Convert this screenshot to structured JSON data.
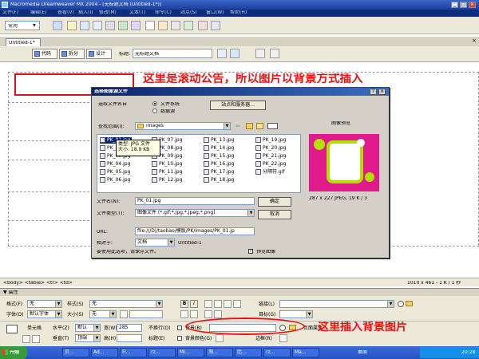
{
  "window": {
    "title": "Macromedia Dreamweaver MX 2004 - [无标题文档 (Untitled-1*)]",
    "menu": [
      "文件(F)",
      "编辑(E)",
      "查看(V)",
      "插入(I)",
      "修改(M)",
      "文本(T)",
      "命令(C)",
      "站点(S)",
      "窗口(W)",
      "帮助(H)"
    ],
    "insert_category": "常用"
  },
  "document": {
    "tab": "Untitled-1*",
    "buttons": {
      "code": "代码",
      "split": "拆分",
      "design": "设计"
    },
    "title_label": "标题:",
    "title_value": "无标题文档"
  },
  "annotations": {
    "top": "这里是滚动公告，所以图片以背景方式插入",
    "bottom": "这里插入背景图片"
  },
  "dialog": {
    "title": "选择图像源文件",
    "select_from_label": "选取文件名自",
    "radio_filesystem": "文件系统",
    "radio_datasource": "数据源",
    "site_server_button": "站点和服务器...",
    "lookin_label": "查找范围(I):",
    "lookin_value": "images",
    "files": [
      [
        "PK_01.jpg",
        "PK_07.jpg",
        "PK_13.jpg",
        "PK_19.jpg"
      ],
      [
        "PK_02.jpg",
        "PK_08.jpg",
        "PK_14.jpg",
        "PK_20.jpg"
      ],
      [
        "PK_03.jpg",
        "PK_09.jpg",
        "PK_15.jpg",
        "PK_21.jpg"
      ],
      [
        "PK_04.jpg",
        "PK_10.jpg",
        "PK_16.jpg",
        "PK_22.jpg"
      ],
      [
        "PK_05.jpg",
        "PK_11.jpg",
        "PK_17.jpg",
        "分隔符.gif"
      ],
      [
        "PK_06.jpg",
        "PK_12.jpg",
        "PK_18.jpg",
        ""
      ]
    ],
    "tooltip_type": "类型: JPG 文件",
    "tooltip_size": "大小: 18.9 KB",
    "filename_label": "文件名(N):",
    "filename_value": "PK_01.jpg",
    "filetype_label": "文件类型(T):",
    "filetype_value": "图像文件 (*.gif;*.jpg;*.jpeg;*.png)",
    "ok_button": "确定",
    "cancel_button": "取消",
    "url_label": "URL:",
    "url_value": "file:///D|/taobao/模版/PK/images/PK_01.jp",
    "relative_label": "相对于:",
    "relative_value": "文档",
    "relative_doc": "Untitled-1",
    "hint": "要使用此选项，请保存文件。",
    "preview_title": "图像预览",
    "preview_checkbox": "预览图像",
    "preview_info": "287 x 227 JPEG, 19 K / 3"
  },
  "status": {
    "tags": "<body> <table> <tr> <td>",
    "size": "1010 x 461 - 1 K / 1 秒"
  },
  "properties": {
    "header": "▼ 属性",
    "format_label": "格式(F)",
    "format_value": "无",
    "style_label": "样式(S)",
    "style_value": "无",
    "font_label": "字体(O)",
    "font_value": "默认字体",
    "size_label": "大小(S)",
    "size_value": "无",
    "bold": "B",
    "italic": "I",
    "link_label": "链接(L)",
    "target_label": "目标(G)",
    "cell_label": "单元格",
    "horz_label": "水平(Z)",
    "horz_value": "默认",
    "width_label": "宽(W)",
    "width_value": "285",
    "nowrap_label": "不换行(O)",
    "bg_label": "背景(B)",
    "vert_label": "垂直(T)",
    "vert_value": "顶端",
    "height_label": "高(H)",
    "header_label": "标题(E)",
    "bgcolor_label": "背景颜色(G)",
    "border_label": "边框(R)",
    "page_props": "页面属性..."
  },
  "taskbar": {
    "start": "开始",
    "tasks": [
      "贝...",
      "Ad...",
      "Fi...",
      "rz...",
      "Mi...",
      "淘...",
      "比...",
      "rz...",
      "Ma..."
    ],
    "desktop": "桌面",
    "time": "20:28"
  },
  "colors": {
    "annotation_red": "#e11111",
    "title_blue": "#1b3f9c",
    "preview_pink": "#e01a8c"
  }
}
